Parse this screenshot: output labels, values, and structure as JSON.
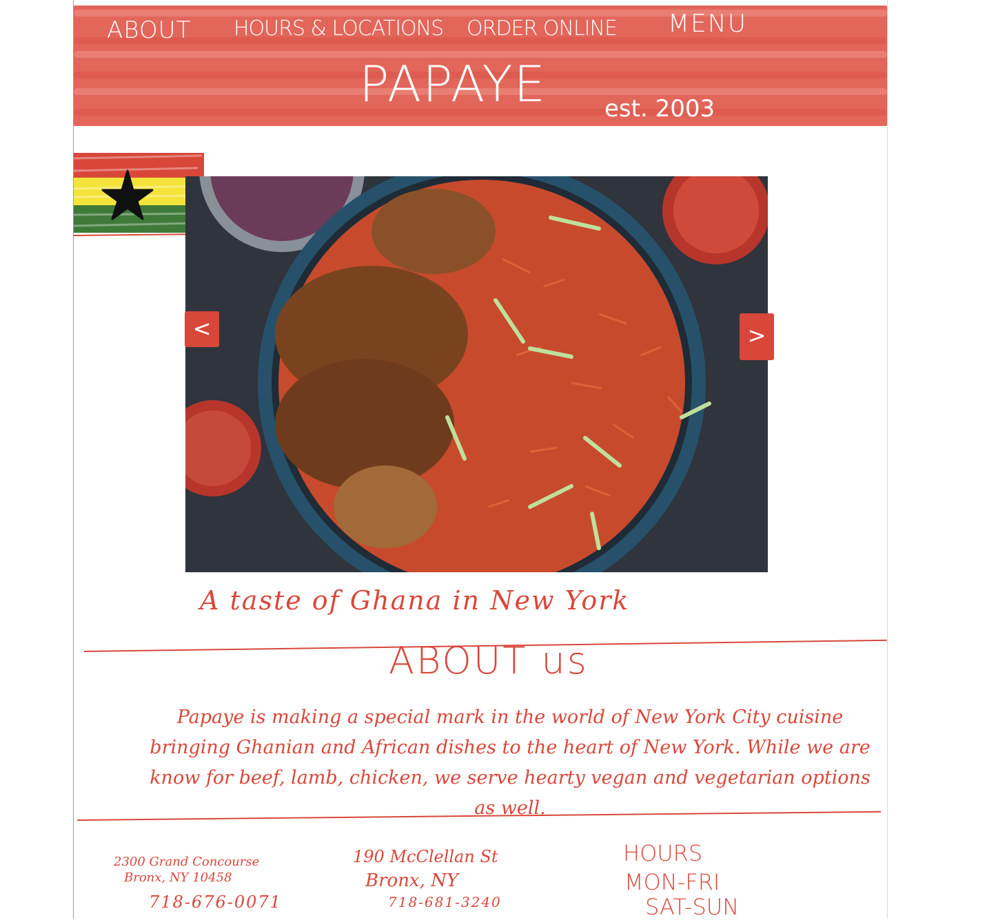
{
  "nav": {
    "about": "ABOUT",
    "hours_locations": "HOURS & LOCATIONS",
    "order_online": "ORDER ONLINE",
    "menu": "MENU"
  },
  "brand": {
    "name": "PAPAYE",
    "established": "est. 2003"
  },
  "colors": {
    "header_red": "#e2665a",
    "accent_red": "#d9473a",
    "flag_red": "#d9473a",
    "flag_yellow": "#f4e43a",
    "flag_green": "#3f7a3a",
    "flag_star": "#111111"
  },
  "carousel": {
    "prev_label": "<",
    "next_label": ">",
    "image_icon": "jollof-rice-chicken-photo"
  },
  "tagline": "A taste of Ghana in New York",
  "about": {
    "title": "ABOUT us",
    "body": "Papaye is making a special mark in the world of New York City cuisine bringing Ghanian and African dishes to the heart of New York. While we are know for beef, lamb, chicken, we serve hearty vegan and vegetarian options as well."
  },
  "locations": [
    {
      "address_line1": "2300 Grand Concourse",
      "address_line2": "Bronx, NY 10458",
      "phone": "718-676-0071"
    },
    {
      "address_line1": "190 McClellan St",
      "address_line2": "Bronx, NY",
      "phone": "718-681-3240"
    }
  ],
  "hours": {
    "title": "HOURS",
    "line1": "MON-FRI",
    "line2": "SAT-SUN"
  }
}
